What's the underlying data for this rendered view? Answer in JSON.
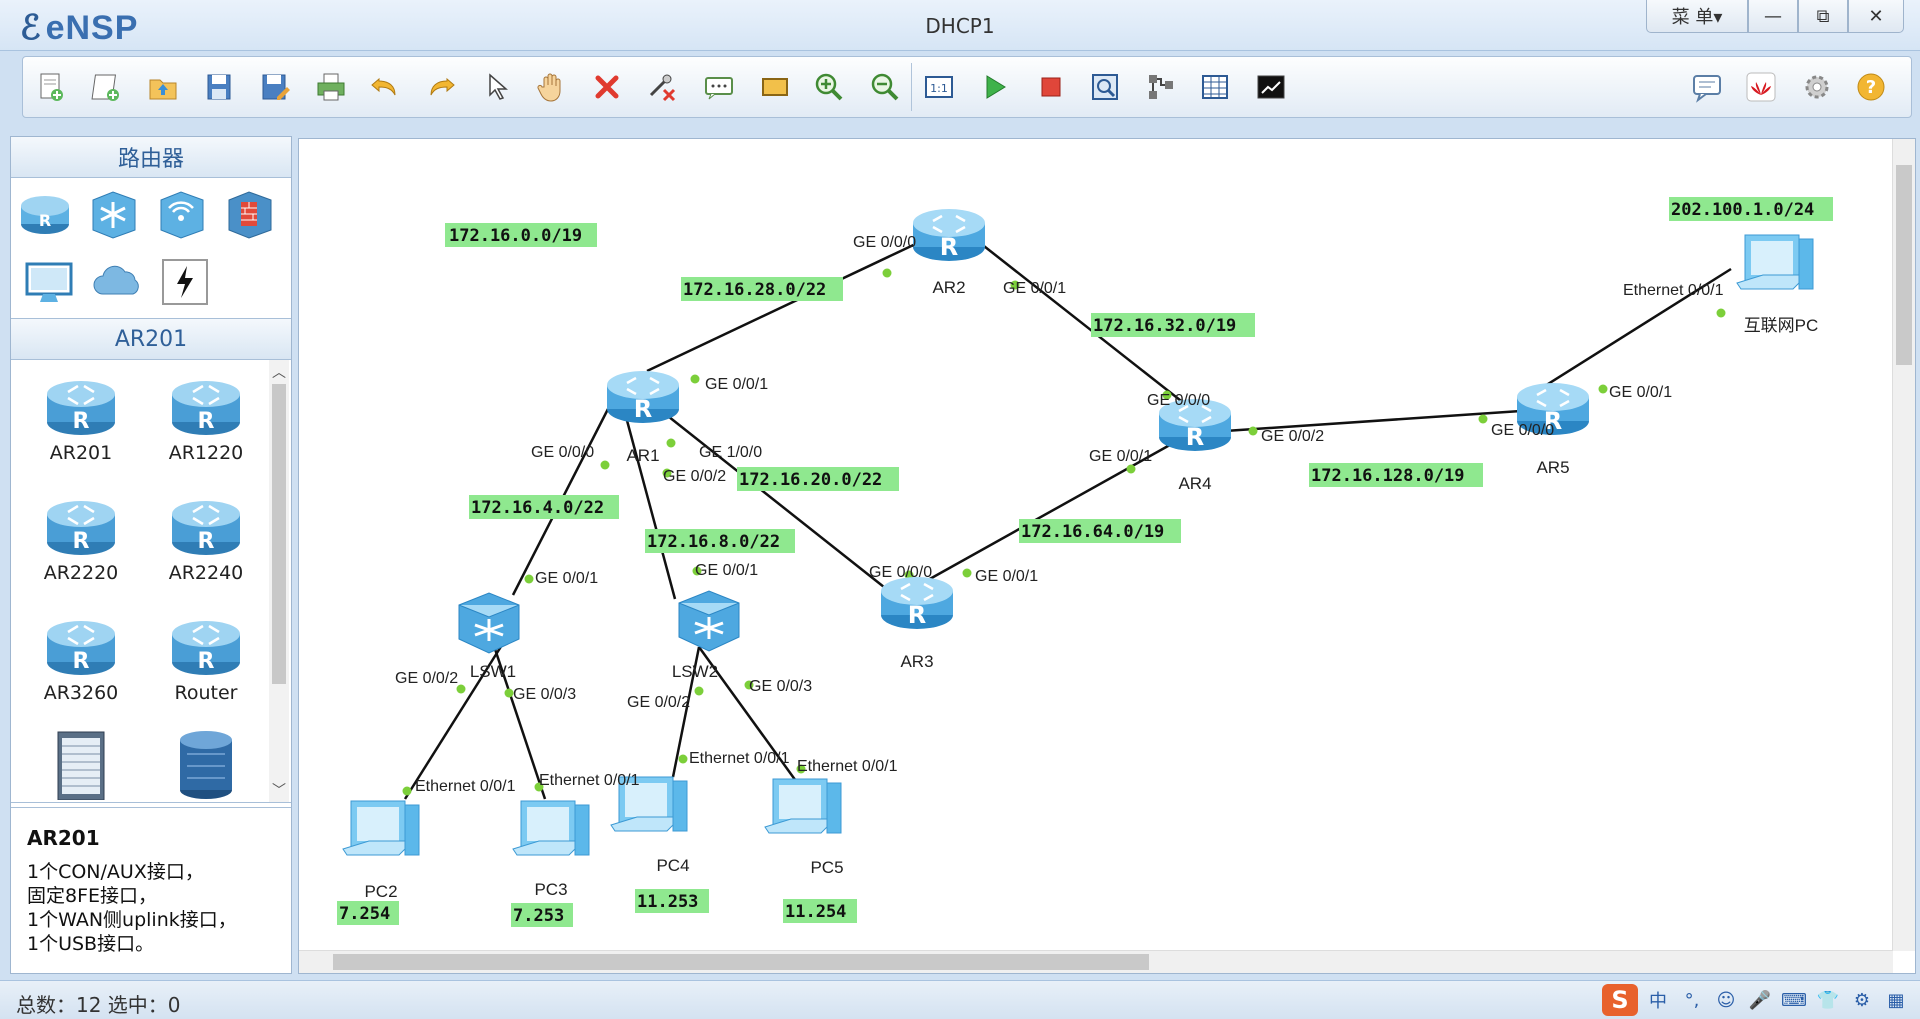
{
  "app": {
    "logo": "eNSP",
    "window_title": "DHCP1"
  },
  "window_controls": {
    "menu": "菜 单▾",
    "minimize": "—",
    "maximize": "⧉",
    "close": "✕"
  },
  "toolbar": {
    "icons": [
      "new-topology-icon",
      "new-example-icon",
      "open-icon",
      "save-icon",
      "save-as-icon",
      "print-icon",
      "undo-icon",
      "redo-icon",
      "select-icon",
      "pan-hand-icon",
      "delete-icon",
      "delete-link-icon",
      "text-note-icon",
      "rectangle-icon",
      "zoom-in-icon",
      "zoom-out-icon",
      "fit-icon",
      "start-icon",
      "stop-icon",
      "capture-icon",
      "topology-icon",
      "grid-icon",
      "cli-icon",
      "chat-icon",
      "huawei-icon",
      "settings-icon",
      "help-icon"
    ]
  },
  "left_panel": {
    "category_title": "路由器",
    "sub_title": "AR201",
    "devices": [
      {
        "label": "AR201"
      },
      {
        "label": "AR1220"
      },
      {
        "label": "AR2220"
      },
      {
        "label": "AR2240"
      },
      {
        "label": "AR3260"
      },
      {
        "label": "Router"
      },
      {
        "label": ""
      },
      {
        "label": ""
      }
    ],
    "description": {
      "title": "AR201",
      "lines": [
        "1个CON/AUX接口，",
        "固定8FE接口，",
        "1个WAN侧uplink接口，",
        "1个USB接口。"
      ]
    }
  },
  "topology": {
    "devices": {
      "AR1": "AR1",
      "AR2": "AR2",
      "AR3": "AR3",
      "AR4": "AR4",
      "AR5": "AR5",
      "LSW1": "LSW1",
      "LSW2": "LSW2",
      "PC2": "PC2",
      "PC3": "PC3",
      "PC4": "PC4",
      "PC5": "PC5",
      "INET": "互联网PC"
    },
    "networks": {
      "n1": "172.16.0.0/19",
      "n2": "172.16.28.0/22",
      "n3": "172.16.32.0/19",
      "n4": "202.100.1.0/24",
      "n5": "172.16.4.0/22",
      "n6": "172.16.20.0/22",
      "n7": "172.16.8.0/22",
      "n8": "172.16.64.0/19",
      "n9": "172.16.128.0/19",
      "h1": "7.254",
      "h2": "7.253",
      "h3": "11.253",
      "h4": "11.254"
    },
    "ports": {
      "ar2_g000": "GE 0/0/0",
      "ar2_g001": "GE 0/0/1",
      "ar1_g001": "GE 0/0/1",
      "ar1_g000": "GE 0/0/0",
      "ar1_g100": "GE 1/0/0",
      "ar1_g002": "GE 0/0/2",
      "ar4_g000": "GE 0/0/0",
      "ar4_g002": "GE 0/0/2",
      "ar4_g001": "GE 0/0/1",
      "ar5_g000": "GE 0/0/0",
      "ar5_g001": "GE 0/0/1",
      "inet_e": "Ethernet 0/0/1",
      "ar3_g000": "GE 0/0/0",
      "ar3_g001": "GE 0/0/1",
      "lsw1_g001": "GE 0/0/1",
      "lsw1_g002": "GE 0/0/2",
      "lsw1_g003": "GE 0/0/3",
      "lsw2_g001": "GE 0/0/1",
      "lsw2_g002": "GE 0/0/2",
      "lsw2_g003": "GE 0/0/3",
      "pc2_e": "Ethernet 0/0/1",
      "pc3_e": "Ethernet 0/0/1",
      "pc4_e": "Ethernet 0/0/1",
      "pc5_e": "Ethernet 0/0/1"
    }
  },
  "status": {
    "text": "总数：12  选中：0"
  },
  "ime": {
    "logo": "S",
    "lang": "中",
    "items": [
      "°,",
      "☺",
      "🎤",
      "⌨",
      "👕",
      "⚙",
      "▦"
    ]
  },
  "colors": {
    "net_label_bg": "#8fe88f",
    "link": "#111111",
    "port_dot": "#7ccf3a",
    "router": "#4aa6d8"
  }
}
